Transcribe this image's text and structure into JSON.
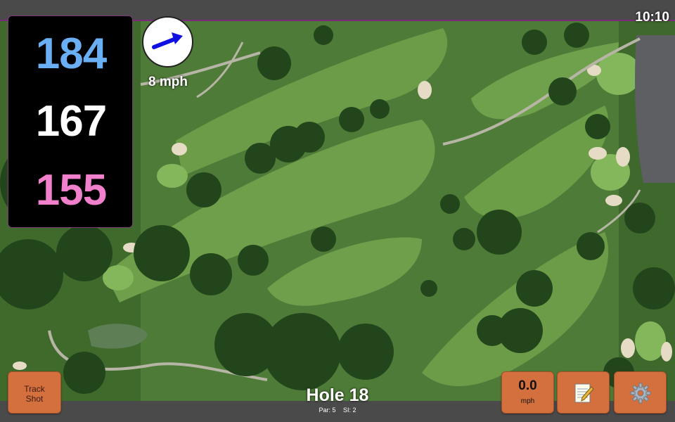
{
  "status_bar": {
    "time": "10:10"
  },
  "distances": {
    "back": "184",
    "middle": "167",
    "front": "155"
  },
  "wind": {
    "speed_text": "8 mph",
    "direction_icon": "arrow-northeast-icon",
    "arrow_color": "#1010e0"
  },
  "hole": {
    "title": "Hole 18",
    "par": "Par: 5",
    "stroke_index": "SI: 2"
  },
  "buttons": {
    "track_shot": {
      "line1": "Track",
      "line2": "Shot"
    },
    "swing_speed": {
      "value": "0.0",
      "unit": "mph"
    },
    "notes": {
      "icon": "notepad-pencil-icon"
    },
    "settings": {
      "icon": "gear-icon"
    }
  },
  "colors": {
    "back_distance": "#6aaef4",
    "middle_distance": "#ffffff",
    "front_distance": "#f07fcc",
    "button": "#d4703d"
  }
}
